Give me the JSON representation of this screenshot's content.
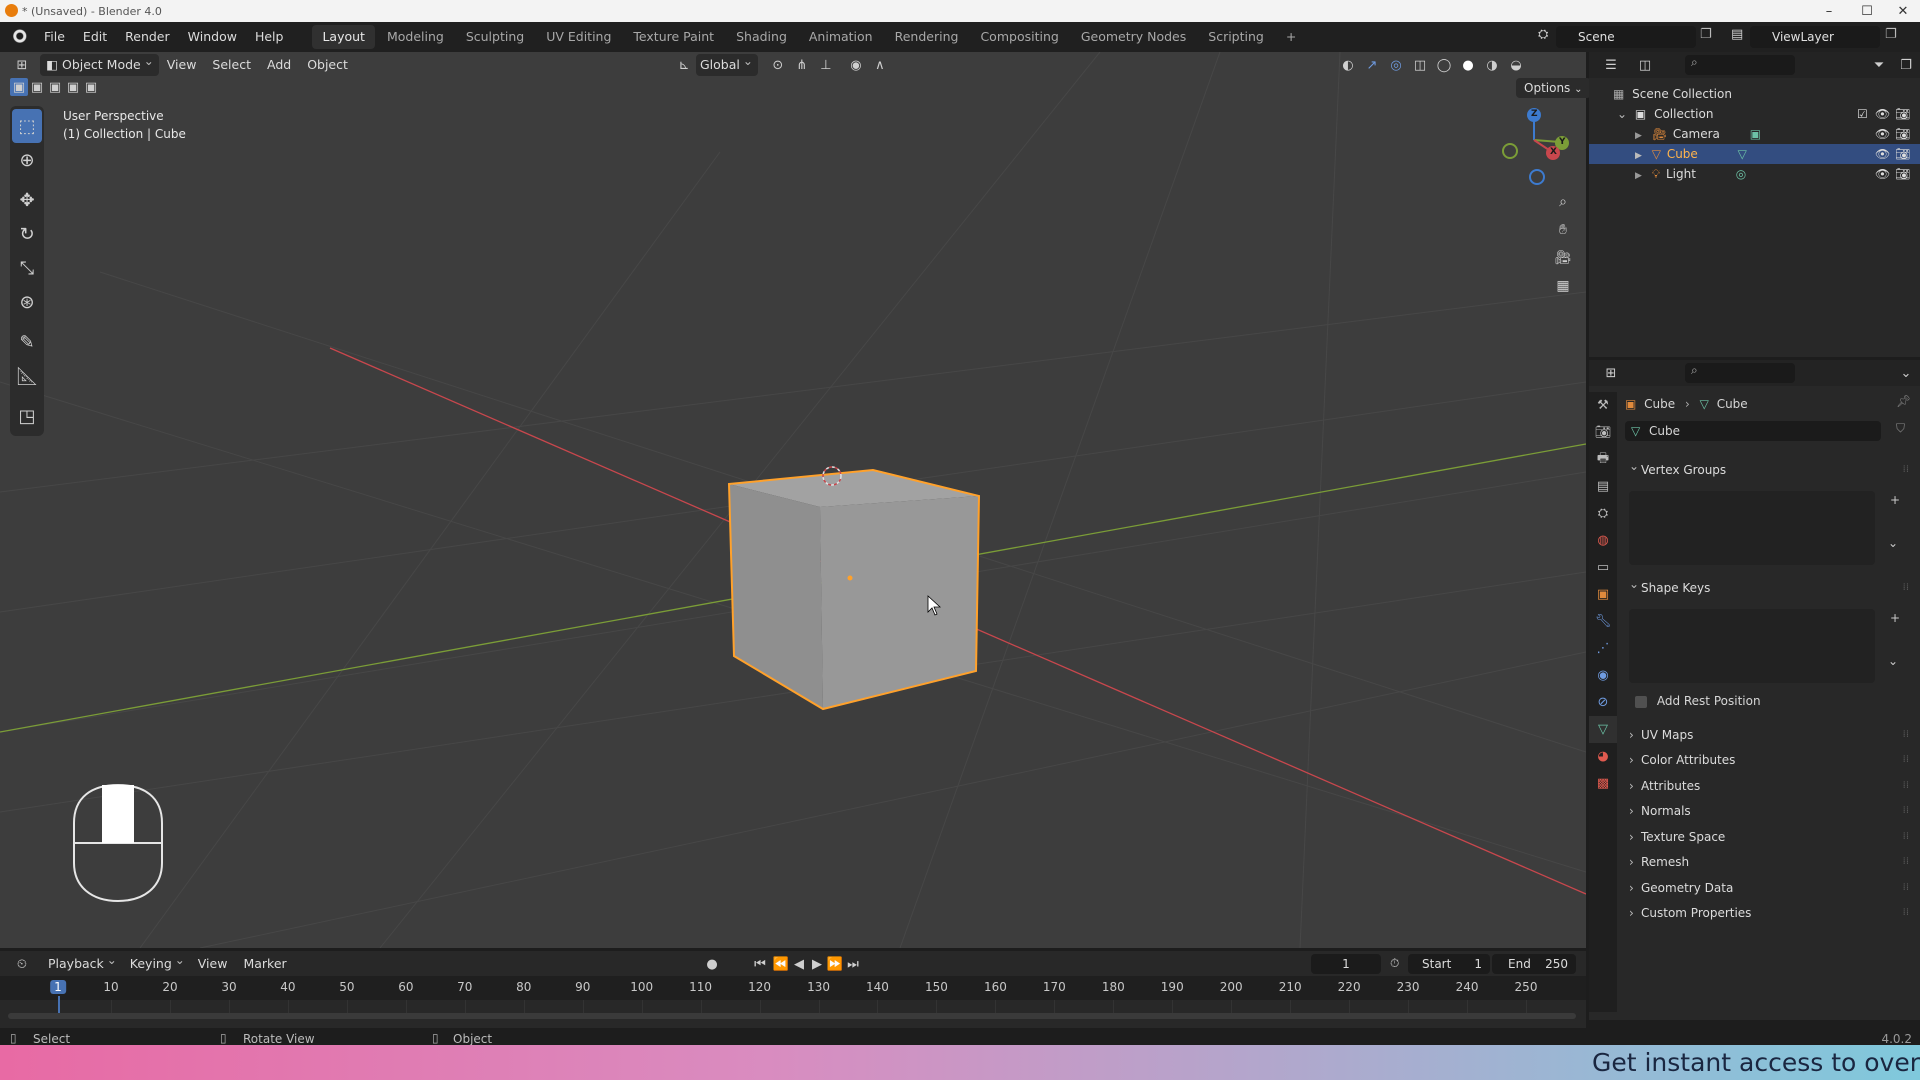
{
  "window": {
    "title": "* (Unsaved) - Blender 4.0"
  },
  "menu": [
    "File",
    "Edit",
    "Render",
    "Window",
    "Help"
  ],
  "workspaces": {
    "tabs": [
      "Layout",
      "Modeling",
      "Sculpting",
      "UV Editing",
      "Texture Paint",
      "Shading",
      "Animation",
      "Rendering",
      "Compositing",
      "Geometry Nodes",
      "Scripting"
    ],
    "active": "Layout",
    "add": "+"
  },
  "scene": {
    "label": "Scene"
  },
  "view_layer": {
    "label": "ViewLayer"
  },
  "viewport_header": {
    "mode": "Object Mode",
    "menus": [
      "View",
      "Select",
      "Add",
      "Object"
    ],
    "orientation": "Global",
    "options": "Options"
  },
  "viewport_info": {
    "line1": "User Perspective",
    "line2": "(1) Collection | Cube"
  },
  "gizmo": {
    "x": "X",
    "y": "Y",
    "z": "Z"
  },
  "outliner": {
    "root": "Scene Collection",
    "collection": "Collection",
    "items": [
      {
        "label": "Camera",
        "selected": false
      },
      {
        "label": "Cube",
        "selected": true
      },
      {
        "label": "Light",
        "selected": false
      }
    ]
  },
  "properties": {
    "breadcrumb": {
      "object": "Cube",
      "data": "Cube"
    },
    "data_name": "Cube",
    "panels": {
      "vertex_groups": "Vertex Groups",
      "shape_keys": "Shape Keys",
      "add_rest_position": "Add Rest Position",
      "collapsed": [
        "UV Maps",
        "Color Attributes",
        "Attributes",
        "Normals",
        "Texture Space",
        "Remesh",
        "Geometry Data",
        "Custom Properties"
      ]
    }
  },
  "timeline": {
    "menus": [
      "Playback",
      "Keying",
      "View",
      "Marker"
    ],
    "current_frame": "1",
    "start_label": "Start",
    "start": "1",
    "end_label": "End",
    "end": "250",
    "ticks": [
      "1",
      "10",
      "20",
      "30",
      "40",
      "50",
      "60",
      "70",
      "80",
      "90",
      "100",
      "110",
      "120",
      "130",
      "140",
      "150",
      "160",
      "170",
      "180",
      "190",
      "200",
      "210",
      "220",
      "230",
      "240",
      "250"
    ]
  },
  "statusbar": {
    "select": "Select",
    "rotate_view": "Rotate View",
    "object": "Object",
    "version": "4.0.2"
  },
  "banner": {
    "text": "Get instant access to over"
  },
  "colors": {
    "accent": "#4772b3",
    "selection": "#ffa12b",
    "axis_x": "#c8474d",
    "axis_y": "#7b9d37"
  }
}
